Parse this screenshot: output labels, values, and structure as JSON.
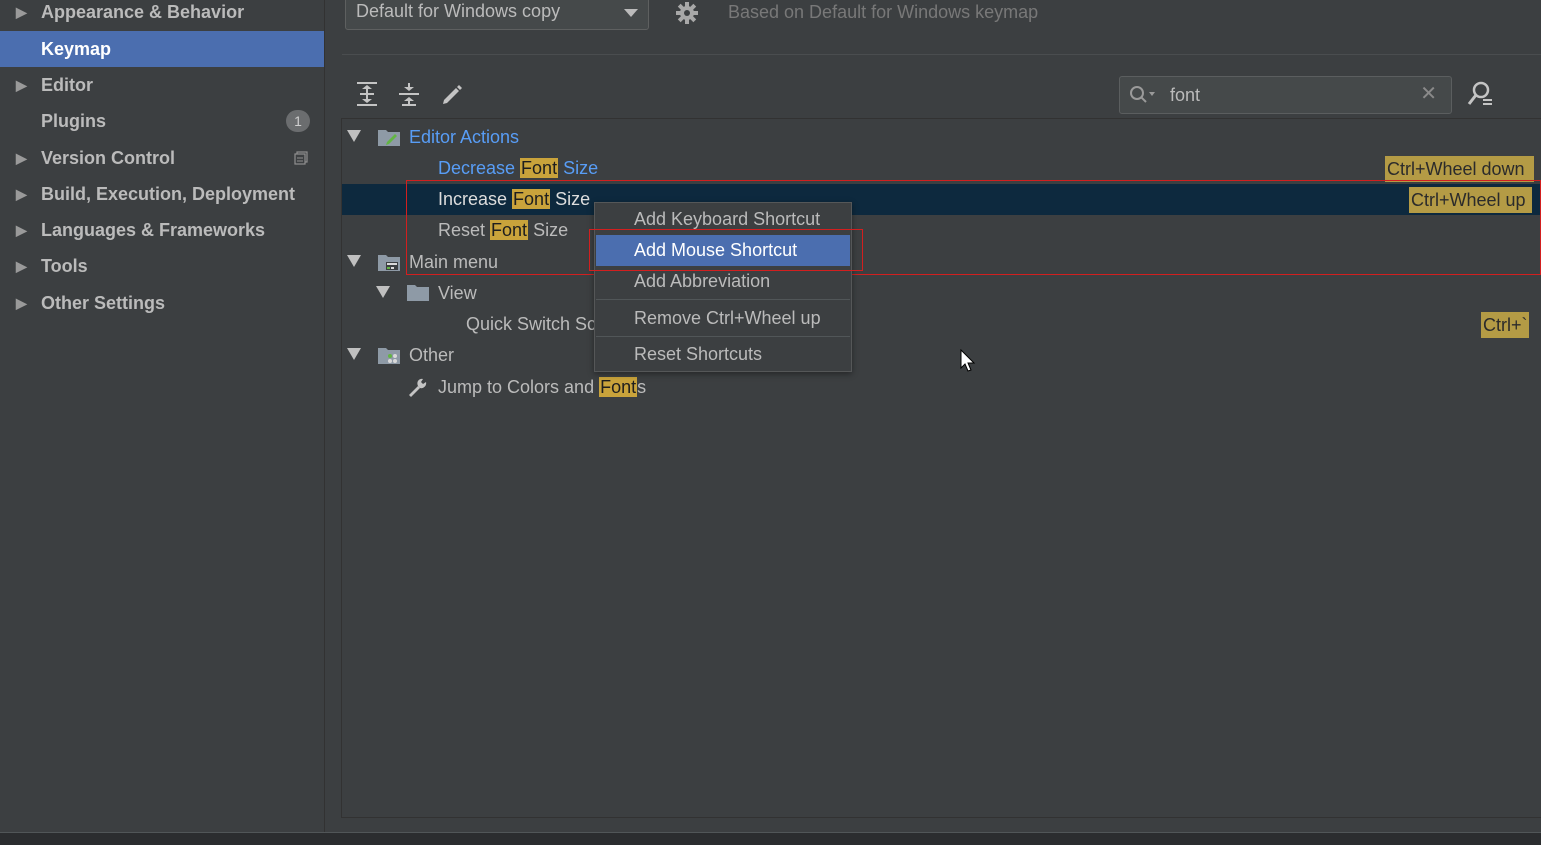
{
  "sidebar": {
    "items": [
      {
        "label": "Appearance & Behavior",
        "expandable": true
      },
      {
        "label": "Keymap",
        "expandable": false,
        "selected": true
      },
      {
        "label": "Editor",
        "expandable": true
      },
      {
        "label": "Plugins",
        "expandable": false,
        "badge": "1"
      },
      {
        "label": "Version Control",
        "expandable": true,
        "icon": "copy-settings-icon"
      },
      {
        "label": "Build, Execution, Deployment",
        "expandable": true
      },
      {
        "label": "Languages & Frameworks",
        "expandable": true
      },
      {
        "label": "Tools",
        "expandable": true
      },
      {
        "label": "Other Settings",
        "expandable": true
      }
    ]
  },
  "header": {
    "keymap_selected": "Default for Windows copy",
    "based_on": "Based on Default for Windows keymap"
  },
  "toolbar": {
    "icons": [
      "expand-all-icon",
      "collapse-all-icon",
      "edit-icon"
    ],
    "search_value": "font",
    "find_shortcut_icon": "find-shortcut-icon"
  },
  "tree": {
    "editor_actions": {
      "label": "Editor Actions",
      "decrease": {
        "pre": "Decrease ",
        "hl": "Font",
        "post": " Size",
        "shortcut": "Ctrl+Wheel down"
      },
      "increase": {
        "pre": "Increase ",
        "hl": "Font",
        "post": " Size",
        "shortcut": "Ctrl+Wheel up"
      },
      "reset": {
        "pre": "Reset ",
        "hl": "Font",
        "post": " Size"
      }
    },
    "main_menu": {
      "label": "Main menu",
      "view": {
        "label": "View",
        "quick_switch": {
          "label": "Quick Switch Sc",
          "shortcut": "Ctrl+`"
        }
      }
    },
    "other": {
      "label": "Other",
      "jump": {
        "pre": "Jump to Colors and ",
        "hl": "Font",
        "post": "s"
      }
    }
  },
  "context_menu": {
    "items": [
      {
        "label": "Add Keyboard Shortcut"
      },
      {
        "label": "Add Mouse Shortcut",
        "active": true
      },
      {
        "label": "Add Abbreviation"
      },
      {
        "label": "Remove Ctrl+Wheel up"
      },
      {
        "label": "Reset Shortcuts"
      }
    ]
  },
  "colors": {
    "background": "#3c3f41",
    "selection": "#4b6eaf",
    "tree_selection": "#0d293e",
    "highlight": "#c9a33b",
    "link_blue": "#589df6",
    "annotation_red": "#d21f1f"
  }
}
